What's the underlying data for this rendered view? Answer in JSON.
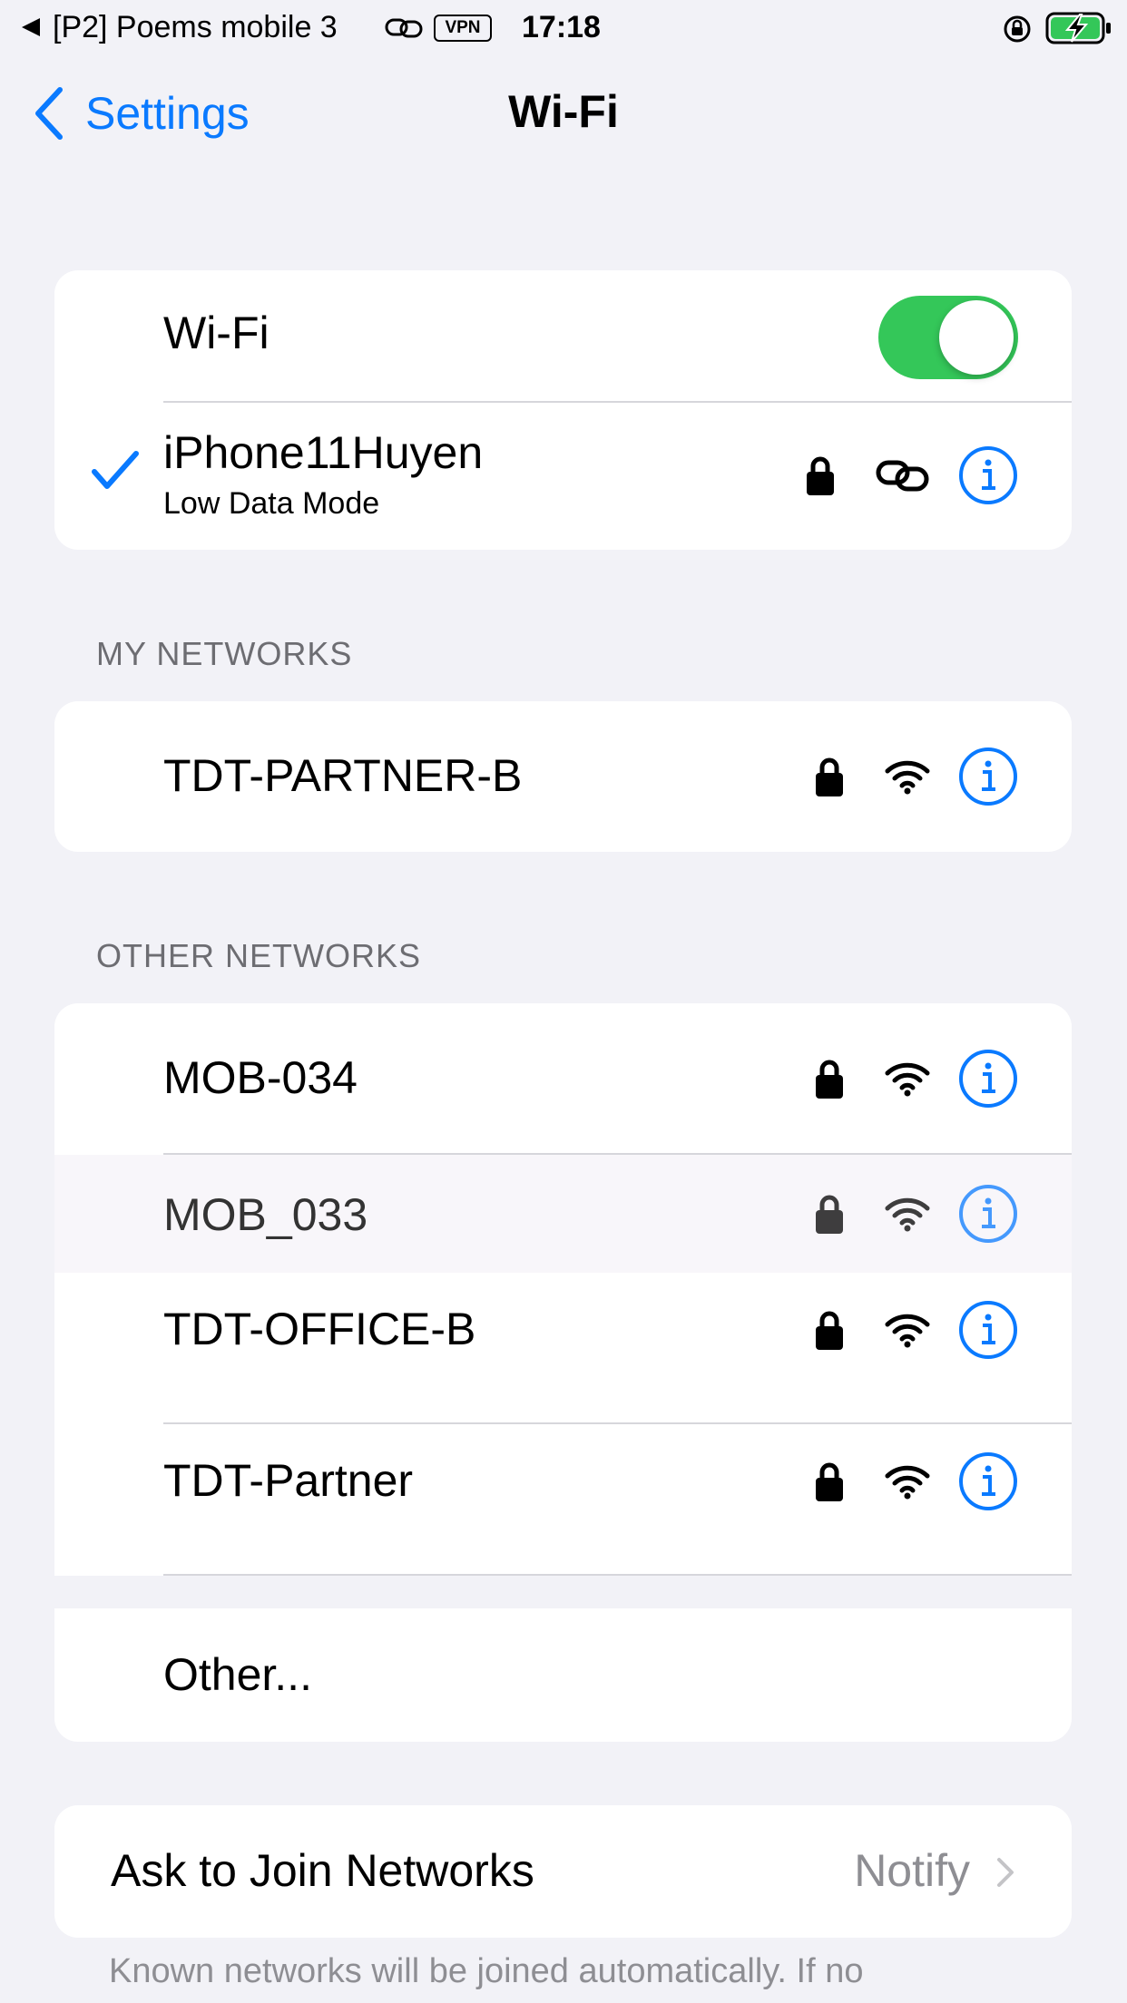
{
  "status_bar": {
    "back_app": "[P2] Poems mobile 3",
    "vpn": "VPN",
    "time": "17:18"
  },
  "nav": {
    "back_label": "Settings",
    "title": "Wi-Fi"
  },
  "wifi_toggle": {
    "label": "Wi-Fi",
    "on": true
  },
  "connected": {
    "name": "iPhone11Huyen",
    "subtitle": "Low Data Mode"
  },
  "my_networks": {
    "header": "MY NETWORKS",
    "items": [
      {
        "name": "TDT-PARTNER-B"
      }
    ]
  },
  "other_networks": {
    "header": "OTHER NETWORKS",
    "items": [
      {
        "name": "MOB-034"
      },
      {
        "name": "MOB_033"
      },
      {
        "name": "TDT-OFFICE-B"
      },
      {
        "name": "TDT-Partner"
      }
    ],
    "other_label": "Other..."
  },
  "ask_to_join": {
    "label": "Ask to Join Networks",
    "value": "Notify"
  },
  "footer": "Known networks will be joined automatically. If no",
  "colors": {
    "accent": "#0a7aff",
    "toggle_on": "#34c759",
    "background": "#f2f2f7"
  }
}
